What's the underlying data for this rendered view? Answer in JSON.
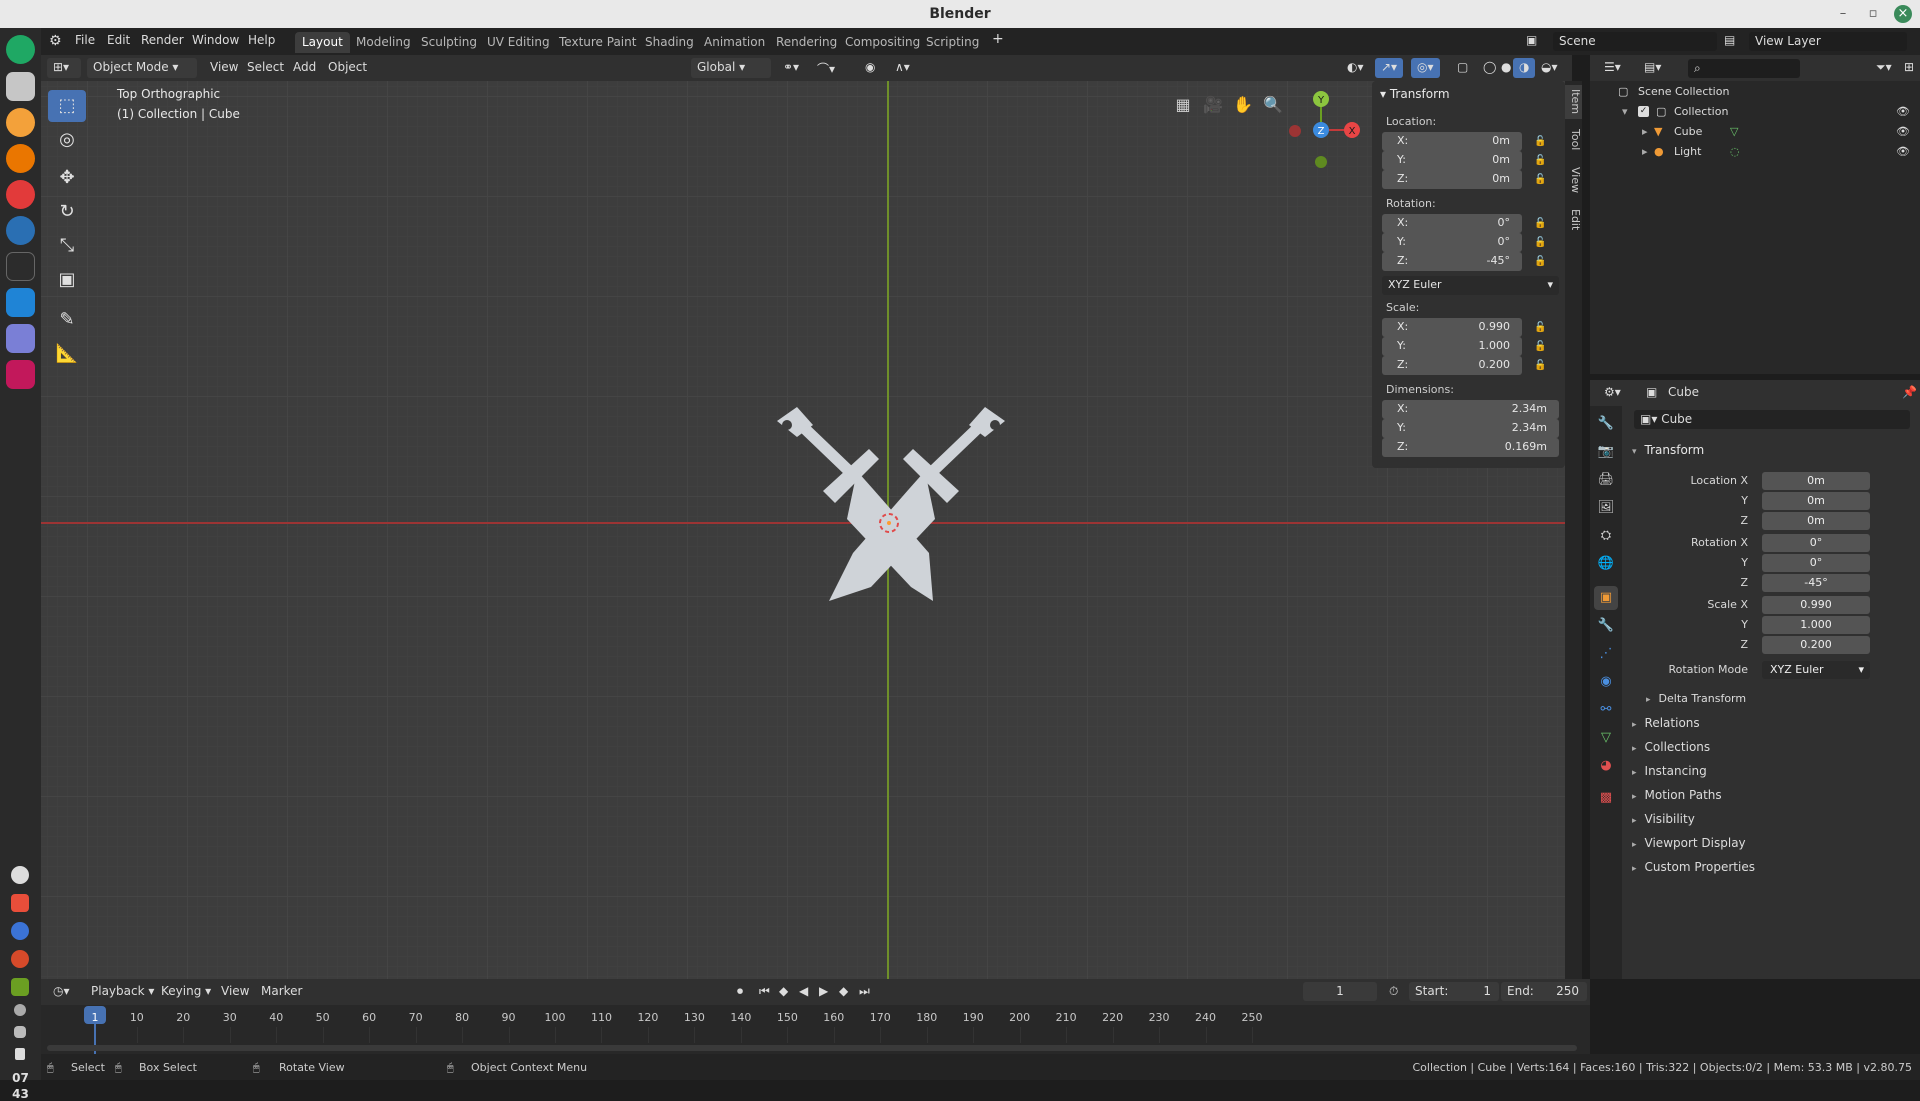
{
  "window": {
    "title": "Blender"
  },
  "menu": {
    "file": "File",
    "edit": "Edit",
    "render": "Render",
    "window": "Window",
    "help": "Help"
  },
  "workspaces": [
    "Layout",
    "Modeling",
    "Sculpting",
    "UV Editing",
    "Texture Paint",
    "Shading",
    "Animation",
    "Rendering",
    "Compositing",
    "Scripting"
  ],
  "scene": {
    "scene_name": "Scene",
    "view_layer": "View Layer"
  },
  "viewport_header": {
    "mode": "Object Mode",
    "view": "View",
    "select": "Select",
    "add": "Add",
    "object": "Object",
    "orientation": "Global"
  },
  "viewport": {
    "view_name": "Top Orthographic",
    "context": "(1) Collection | Cube"
  },
  "gizmo": {
    "x": "X",
    "y": "Y",
    "z": "Z"
  },
  "npanel": {
    "header": "Transform",
    "tabs": [
      "Item",
      "Tool",
      "View",
      "Edit"
    ],
    "location_label": "Location:",
    "location": [
      {
        "k": "X:",
        "v": "0m"
      },
      {
        "k": "Y:",
        "v": "0m"
      },
      {
        "k": "Z:",
        "v": "0m"
      }
    ],
    "rotation_label": "Rotation:",
    "rotation": [
      {
        "k": "X:",
        "v": "0°"
      },
      {
        "k": "Y:",
        "v": "0°"
      },
      {
        "k": "Z:",
        "v": "-45°"
      }
    ],
    "rotation_mode": "XYZ Euler",
    "scale_label": "Scale:",
    "scale": [
      {
        "k": "X:",
        "v": "0.990"
      },
      {
        "k": "Y:",
        "v": "1.000"
      },
      {
        "k": "Z:",
        "v": "0.200"
      }
    ],
    "dimensions_label": "Dimensions:",
    "dimensions": [
      {
        "k": "X:",
        "v": "2.34m"
      },
      {
        "k": "Y:",
        "v": "2.34m"
      },
      {
        "k": "Z:",
        "v": "0.169m"
      }
    ]
  },
  "outliner": {
    "scene_collection": "Scene Collection",
    "collection": "Collection",
    "items": [
      "Cube",
      "Light"
    ]
  },
  "properties": {
    "object_name": "Cube",
    "data_name": "Cube",
    "transform_header": "Transform",
    "rows": [
      {
        "label": "Location X",
        "value": "0m"
      },
      {
        "label": "Y",
        "value": "0m"
      },
      {
        "label": "Z",
        "value": "0m"
      },
      {
        "label": "Rotation X",
        "value": "0°"
      },
      {
        "label": "Y",
        "value": "0°"
      },
      {
        "label": "Z",
        "value": "-45°"
      },
      {
        "label": "Scale X",
        "value": "0.990"
      },
      {
        "label": "Y",
        "value": "1.000"
      },
      {
        "label": "Z",
        "value": "0.200"
      }
    ],
    "rotation_mode_label": "Rotation Mode",
    "rotation_mode": "XYZ Euler",
    "delta_transform": "Delta Transform",
    "sections": [
      "Relations",
      "Collections",
      "Instancing",
      "Motion Paths",
      "Visibility",
      "Viewport Display",
      "Custom Properties"
    ]
  },
  "timeline": {
    "playback": "Playback",
    "keying": "Keying",
    "view": "View",
    "marker": "Marker",
    "current_frame": "1",
    "start_label": "Start:",
    "start": "1",
    "end_label": "End:",
    "end": "250",
    "ticks": [
      "1",
      "10",
      "20",
      "30",
      "40",
      "50",
      "60",
      "70",
      "80",
      "90",
      "100",
      "110",
      "120",
      "130",
      "140",
      "150",
      "160",
      "170",
      "180",
      "190",
      "200",
      "210",
      "220",
      "230",
      "240",
      "250"
    ]
  },
  "statusbar": {
    "select": "Select",
    "box_select": "Box Select",
    "rotate_view": "Rotate View",
    "context_menu": "Object Context Menu",
    "stats": "Collection | Cube | Verts:164 | Faces:160 | Tris:322 | Objects:0/2 | Mem: 53.3 MB | v2.80.75"
  },
  "clock": {
    "hour": "07",
    "minute": "43"
  },
  "colors": {
    "accent": "#4772b3",
    "x_axis": "#c33a3a",
    "y_axis": "#6b9f22",
    "object": "#cfd3d8"
  }
}
